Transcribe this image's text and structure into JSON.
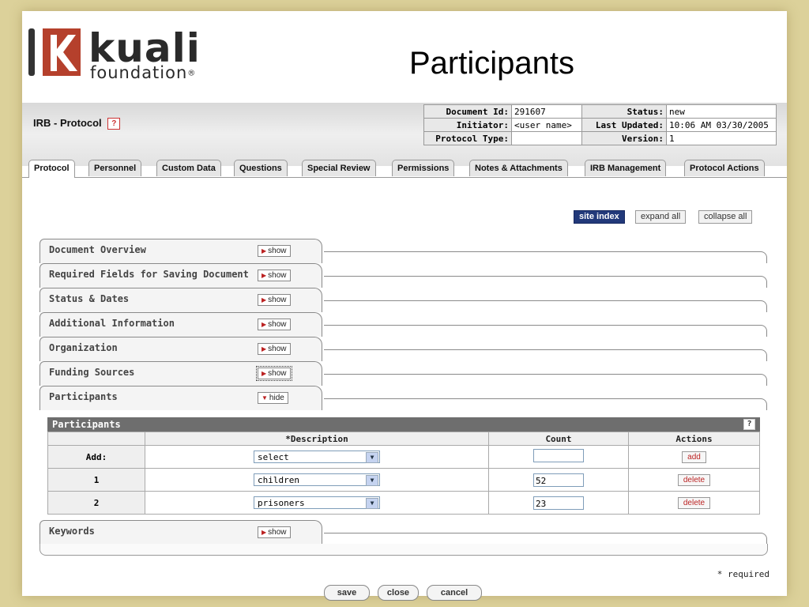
{
  "slide": {
    "title": "Participants"
  },
  "logo": {
    "brand_line1": "kuali",
    "brand_line2": "foundation",
    "reg": "®"
  },
  "doc": {
    "title": "IRB - Protocol",
    "help": "?",
    "info": [
      {
        "label": "Document Id:",
        "value": "291607",
        "label2": "Status:",
        "value2": "new"
      },
      {
        "label": "Initiator:",
        "value": "<user name>",
        "label2": "Last Updated:",
        "value2": "10:06 AM 03/30/2005"
      },
      {
        "label": "Protocol Type:",
        "value": "",
        "label2": "Version:",
        "value2": "1"
      }
    ]
  },
  "tabs": [
    "Protocol",
    "Personnel",
    "Custom Data",
    "Questions",
    "Special Review",
    "Permissions",
    "Notes & Attachments",
    "IRB Management",
    "Protocol Actions"
  ],
  "top_buttons": {
    "site_index": "site index",
    "expand_all": "expand all",
    "collapse_all": "collapse all"
  },
  "sections": [
    {
      "label": "Document Overview",
      "toggle": "show"
    },
    {
      "label": "Required Fields for Saving Document",
      "toggle": "show"
    },
    {
      "label": "Status & Dates",
      "toggle": "show"
    },
    {
      "label": "Additional Information",
      "toggle": "show"
    },
    {
      "label": "Organization",
      "toggle": "show"
    },
    {
      "label": "Funding Sources",
      "toggle": "show"
    },
    {
      "label": "Participants",
      "toggle": "hide"
    },
    {
      "label": "Keywords",
      "toggle": "show"
    }
  ],
  "participants": {
    "header": "Participants",
    "help": "?",
    "columns": [
      "",
      "*Description",
      "Count",
      "Actions"
    ],
    "rows": [
      {
        "label": "Add:",
        "description": "select",
        "count": "",
        "action": "add"
      },
      {
        "label": "1",
        "description": "children",
        "count": "52",
        "action": "delete"
      },
      {
        "label": "2",
        "description": "prisoners",
        "count": "23",
        "action": "delete"
      }
    ]
  },
  "required_note": "* required",
  "bottom_buttons": {
    "save": "save",
    "close": "close",
    "cancel": "cancel"
  },
  "colors": {
    "background": "#dcd19a",
    "site_index": "#22397a",
    "logo_red": "#b5402c"
  }
}
